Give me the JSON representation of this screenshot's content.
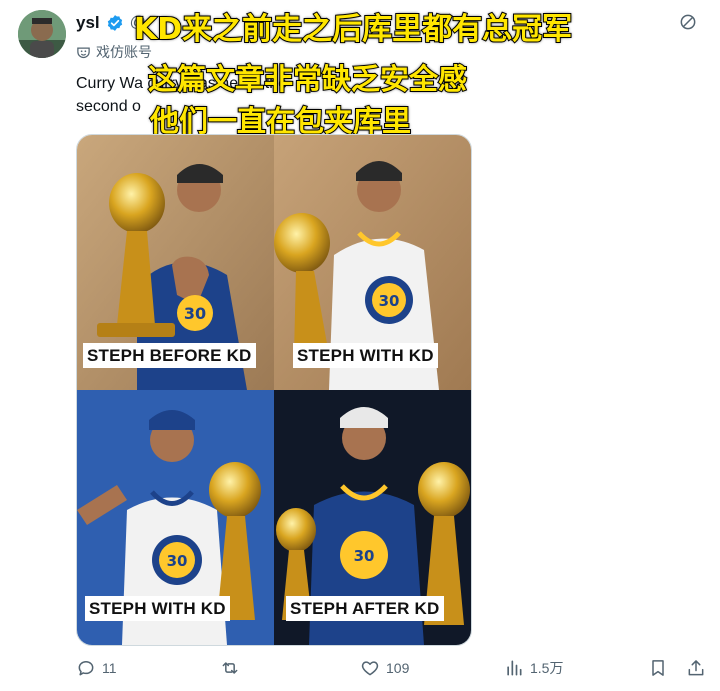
{
  "author": {
    "display_name": "ysl",
    "handle": "@",
    "parody_label": "戏仿账号"
  },
  "tweet": {
    "line1": "Curry Wa                                                                   curry was never the",
    "line2": "second o                                         "
  },
  "captions": {
    "line1": "KD来之前走之后库里都有总冠军",
    "line2": "这篇文章非常缺乏安全感",
    "line3": "他们一直在包夹库里"
  },
  "media": {
    "panels": [
      {
        "label": "STEPH BEFORE KD"
      },
      {
        "label": "STEPH WITH KD"
      },
      {
        "label": "STEPH WITH KD"
      },
      {
        "label": "STEPH AFTER KD"
      }
    ]
  },
  "actions": {
    "replies": "11",
    "retweets": "",
    "likes": "109",
    "views": "1.5万"
  },
  "colors": {
    "brand_blue": "#1d9bf0",
    "caption_yellow": "#ffe600",
    "warriors_blue": "#1d428a",
    "warriors_gold": "#ffc72c"
  },
  "icons": [
    "verified-badge-icon",
    "parody-mask-icon",
    "more-icon",
    "reply-icon",
    "retweet-icon",
    "like-icon",
    "views-icon",
    "bookmark-icon",
    "share-icon"
  ]
}
